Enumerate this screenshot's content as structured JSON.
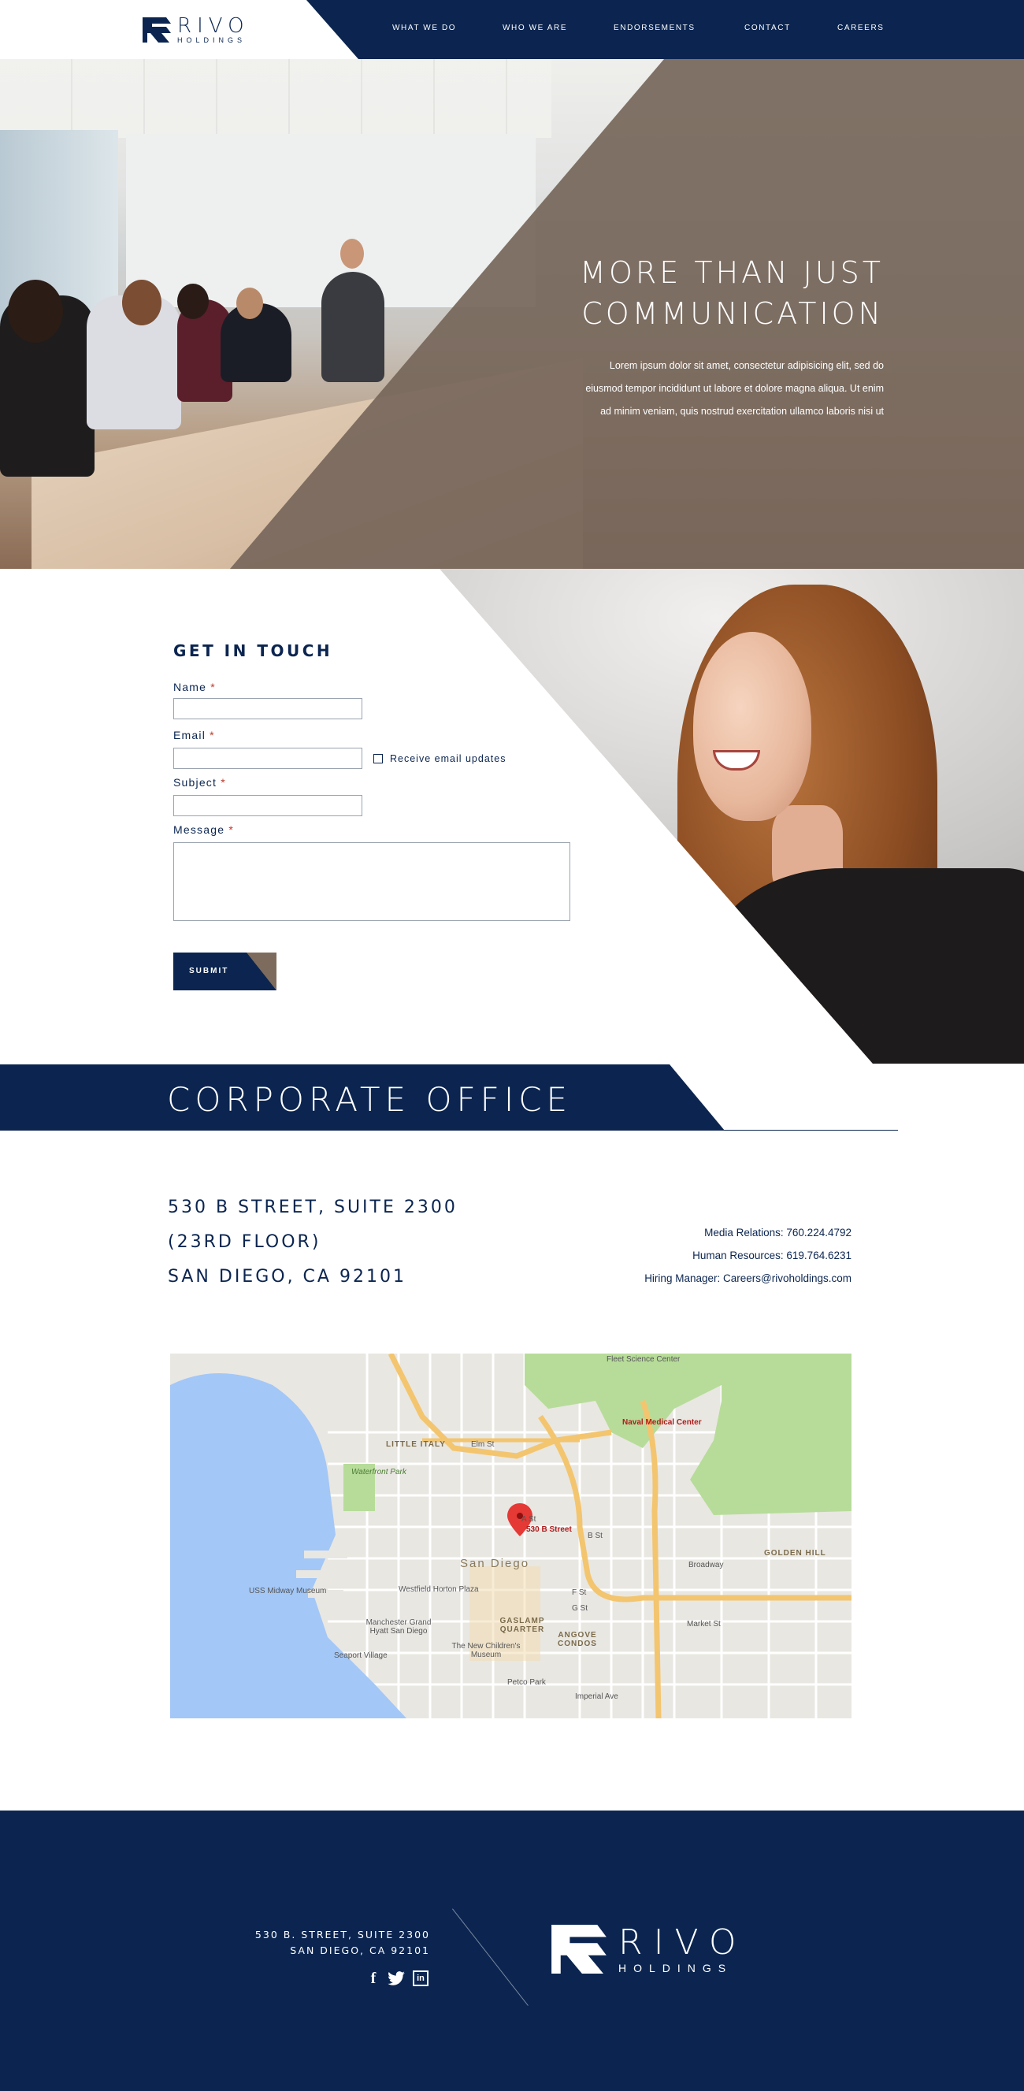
{
  "header": {
    "brand": {
      "name": "RIVO",
      "sub": "HOLDINGS"
    },
    "nav": [
      {
        "label": "What we do"
      },
      {
        "label": "Who we are"
      },
      {
        "label": "Endorsements"
      },
      {
        "label": "Contact"
      },
      {
        "label": "Careers"
      }
    ]
  },
  "hero": {
    "title_line1": "More than just",
    "title_line2": "communication",
    "body_line1": "Lorem ipsum dolor sit amet, consectetur adipisicing elit, sed do",
    "body_line2": "eiusmod tempor incididunt ut labore et dolore magna aliqua. Ut enim",
    "body_line3": "ad minim veniam, quis nostrud exercitation ullamco laboris nisi ut"
  },
  "contact_form": {
    "title": "Get in touch",
    "name_label": "Name",
    "email_label": "Email",
    "subject_label": "Subject",
    "message_label": "Message",
    "required_mark": "*",
    "checkbox_label": "Receive email updates",
    "submit_label": "Submit"
  },
  "office": {
    "title": "Corporate Office",
    "address_line1": "530 B Street, Suite 2300",
    "address_line2": "(23rd floor)",
    "address_line3": "San Diego, CA 92101",
    "media_relations": "Media Relations: 760.224.4792",
    "human_resources": "Human Resources: 619.764.6231",
    "hiring_manager": "Hiring Manager: Careers@rivoholdings.com"
  },
  "map": {
    "pin_label": "530 B Street",
    "labels": {
      "fleet": "Fleet Science Center",
      "naval": "Naval Medical Center",
      "little_italy": "LITTLE ITALY",
      "waterfront": "Waterfront Park",
      "san_diego": "San Diego",
      "golden_hill": "GOLDEN HILL",
      "midway": "USS Midway Museum",
      "horton": "Westfield Horton Plaza",
      "manchester": "Manchester Grand Hyatt San Diego",
      "gaslamp": "GASLAMP QUARTER",
      "ancove": "ANGOVE CONDOS",
      "seaport": "Seaport Village",
      "childrens": "The New Children's Museum",
      "petco": "Petco Park",
      "broadway": "Broadway",
      "market": "Market St",
      "imperial": "Imperial Ave",
      "elm": "Elm St",
      "a_st": "A St",
      "b_st": "B St",
      "f_st": "F St",
      "g_st": "G St"
    },
    "colors": {
      "water": "#a3c7f7",
      "park": "#b7dc9a",
      "highway": "#f3c56f",
      "land": "#e9e7e2"
    }
  },
  "footer": {
    "address_line1": "530 B. Street, Suite 2300",
    "address_line2": "San Diego, CA 92101",
    "social": [
      {
        "icon": "facebook-icon",
        "glyph": "f"
      },
      {
        "icon": "twitter-icon",
        "glyph": "t"
      },
      {
        "icon": "linkedin-icon",
        "glyph": "in"
      }
    ],
    "brand": {
      "name": "RIVO",
      "sub": "HOLDINGS"
    }
  },
  "colors": {
    "navy": "#0b2550",
    "taupe": "#76665a",
    "required": "#c0392b"
  }
}
